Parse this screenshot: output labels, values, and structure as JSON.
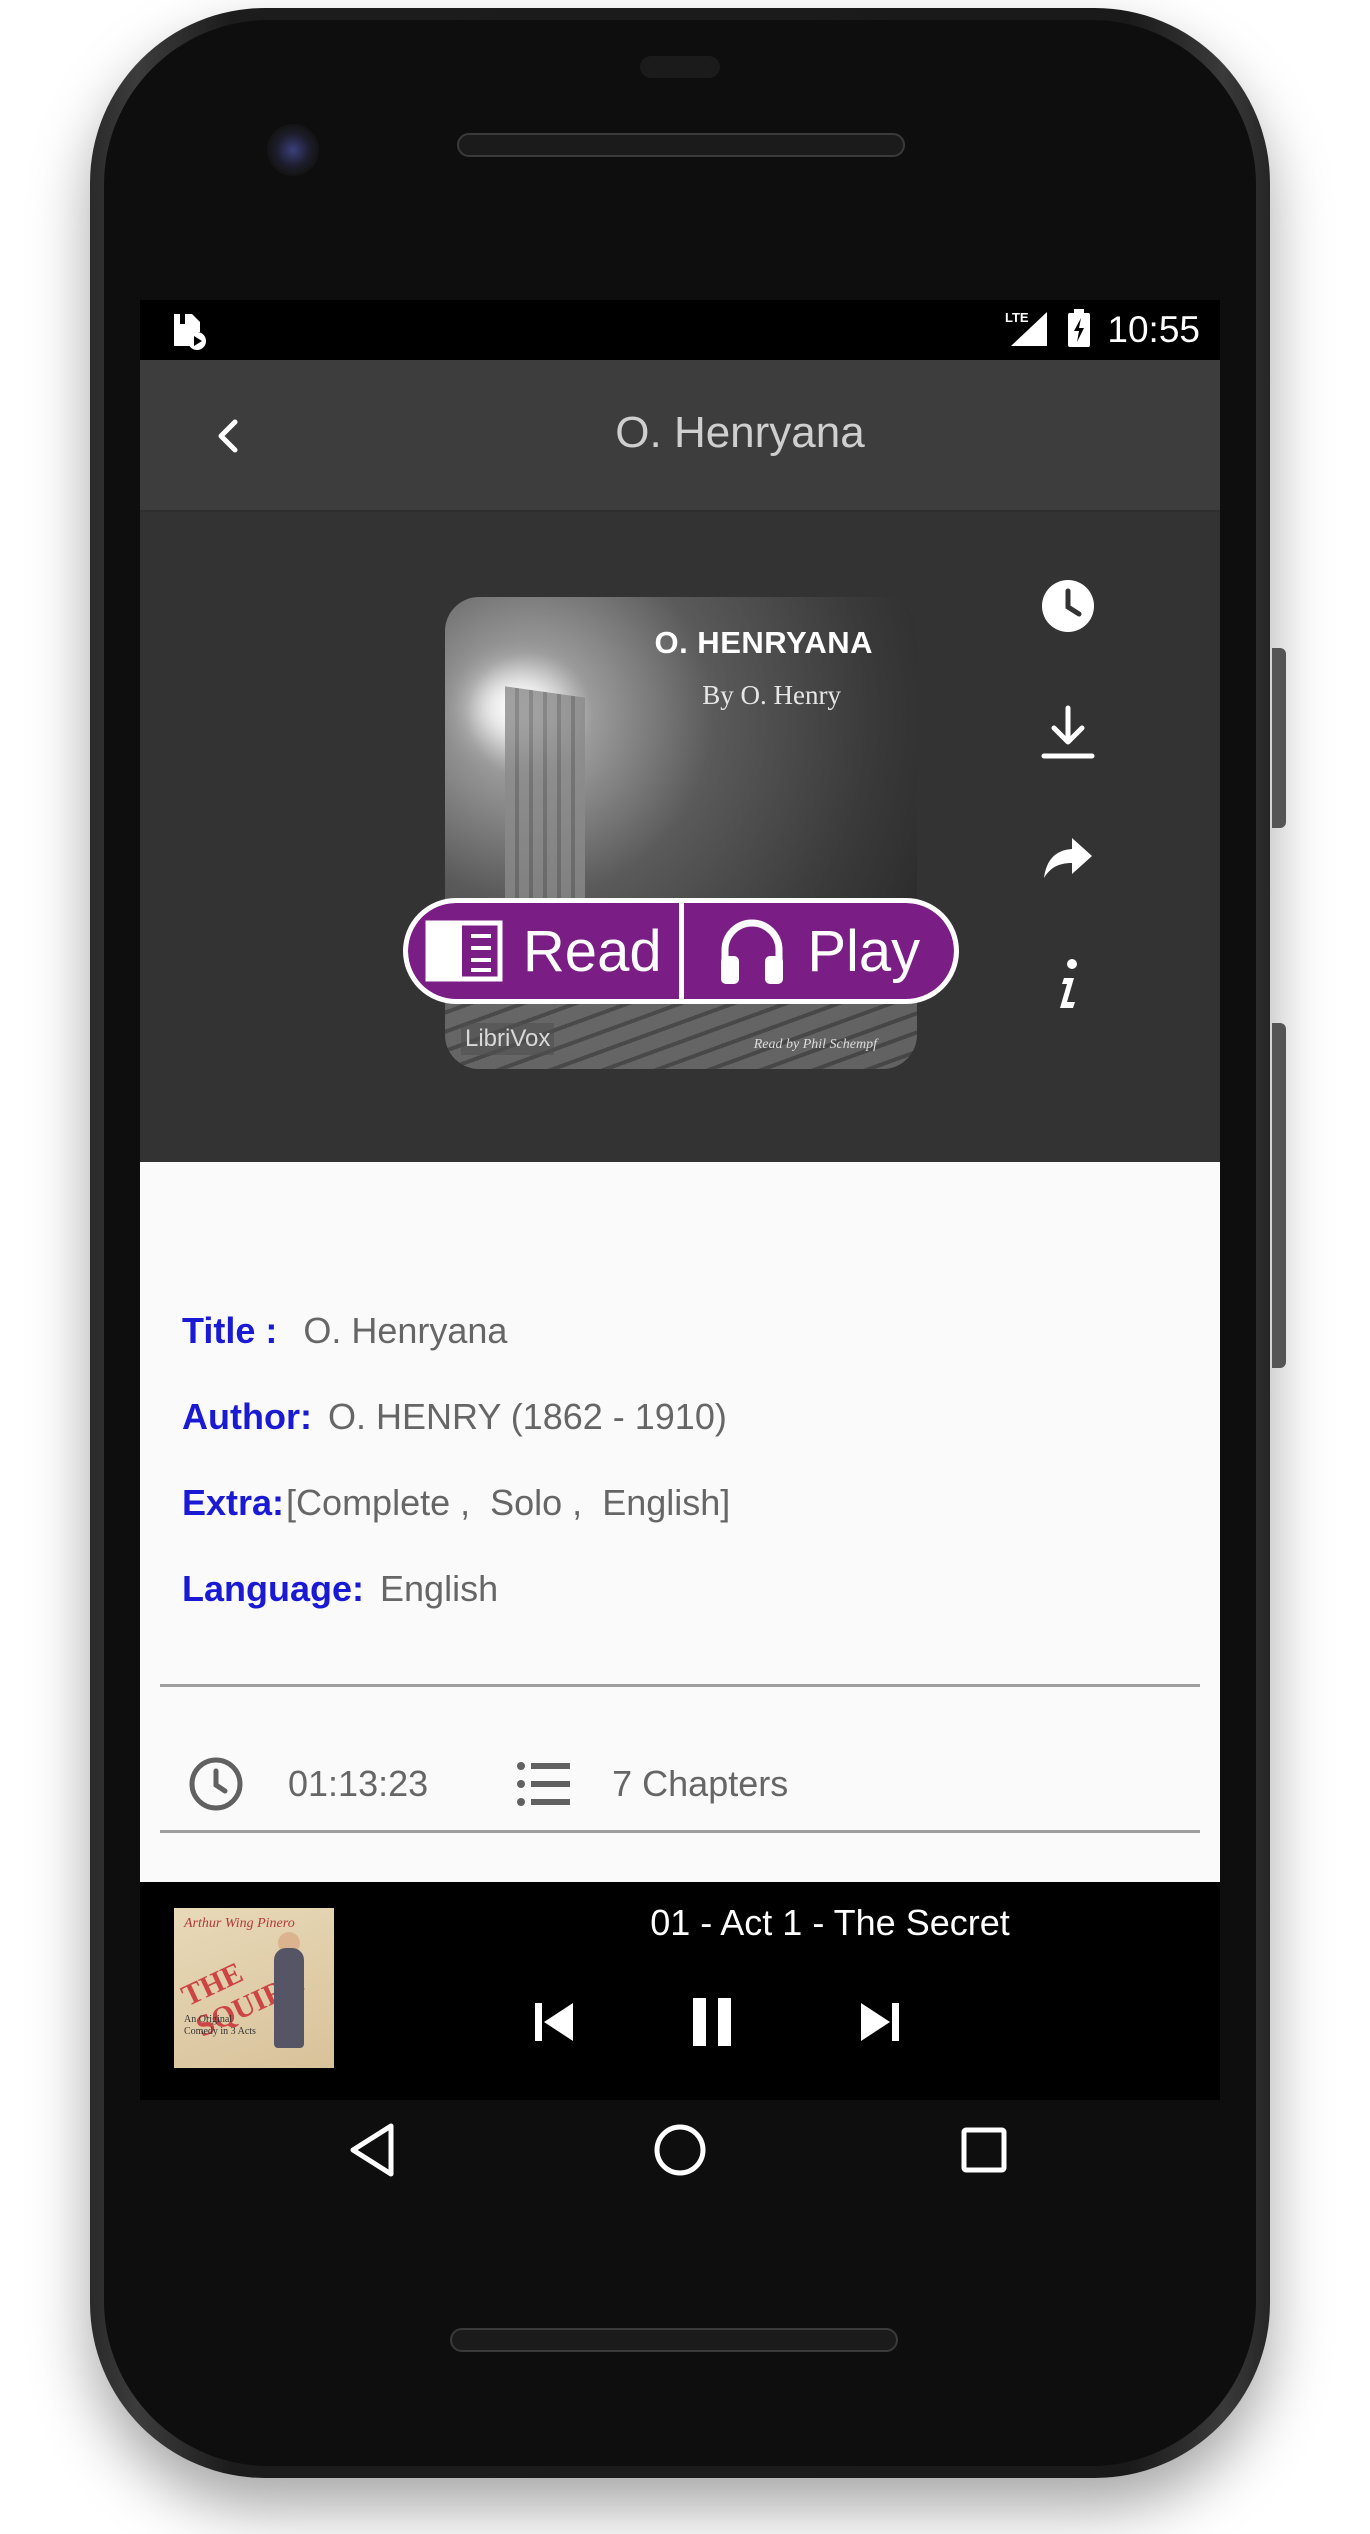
{
  "status_bar": {
    "time": "10:55",
    "network": "LTE",
    "icons": [
      "app-notification-icon",
      "lte-signal-icon",
      "battery-charging-icon"
    ]
  },
  "app_bar": {
    "title": "O. Henryana",
    "back_icon": "chevron-left-icon"
  },
  "book": {
    "cover": {
      "title": "O. HENRYANA",
      "author_line": "By O. Henry",
      "brand": "LibriVox",
      "narrator": "Read by Phil Schempf"
    },
    "side_actions": [
      "clock-icon",
      "download-icon",
      "share-icon",
      "info-icon"
    ],
    "read_label": "Read",
    "play_label": "Play",
    "details": {
      "title_label": "Title :",
      "title_value": "O. Henryana",
      "author_label": "Author:",
      "author_value": "O. HENRY (1862 - 1910)",
      "extra_label": "Extra:",
      "extra_value": "[Complete ,  Solo ,  English]",
      "language_label": "Language:",
      "language_value": "English"
    },
    "duration": "01:13:23",
    "chapters": "7 Chapters"
  },
  "mini_player": {
    "track_title": "01 - Act 1 - The Secret",
    "cover": {
      "line1": "Arthur Wing Pinero",
      "line2": "THE SQUIRE",
      "line3": "An Original Comedy in 3 Acts"
    },
    "state": "playing"
  },
  "colors": {
    "accent": "#7a1d85",
    "label_blue": "#1a1ad4",
    "app_bar": "#3d3d3d",
    "hero_bg": "#333333"
  }
}
